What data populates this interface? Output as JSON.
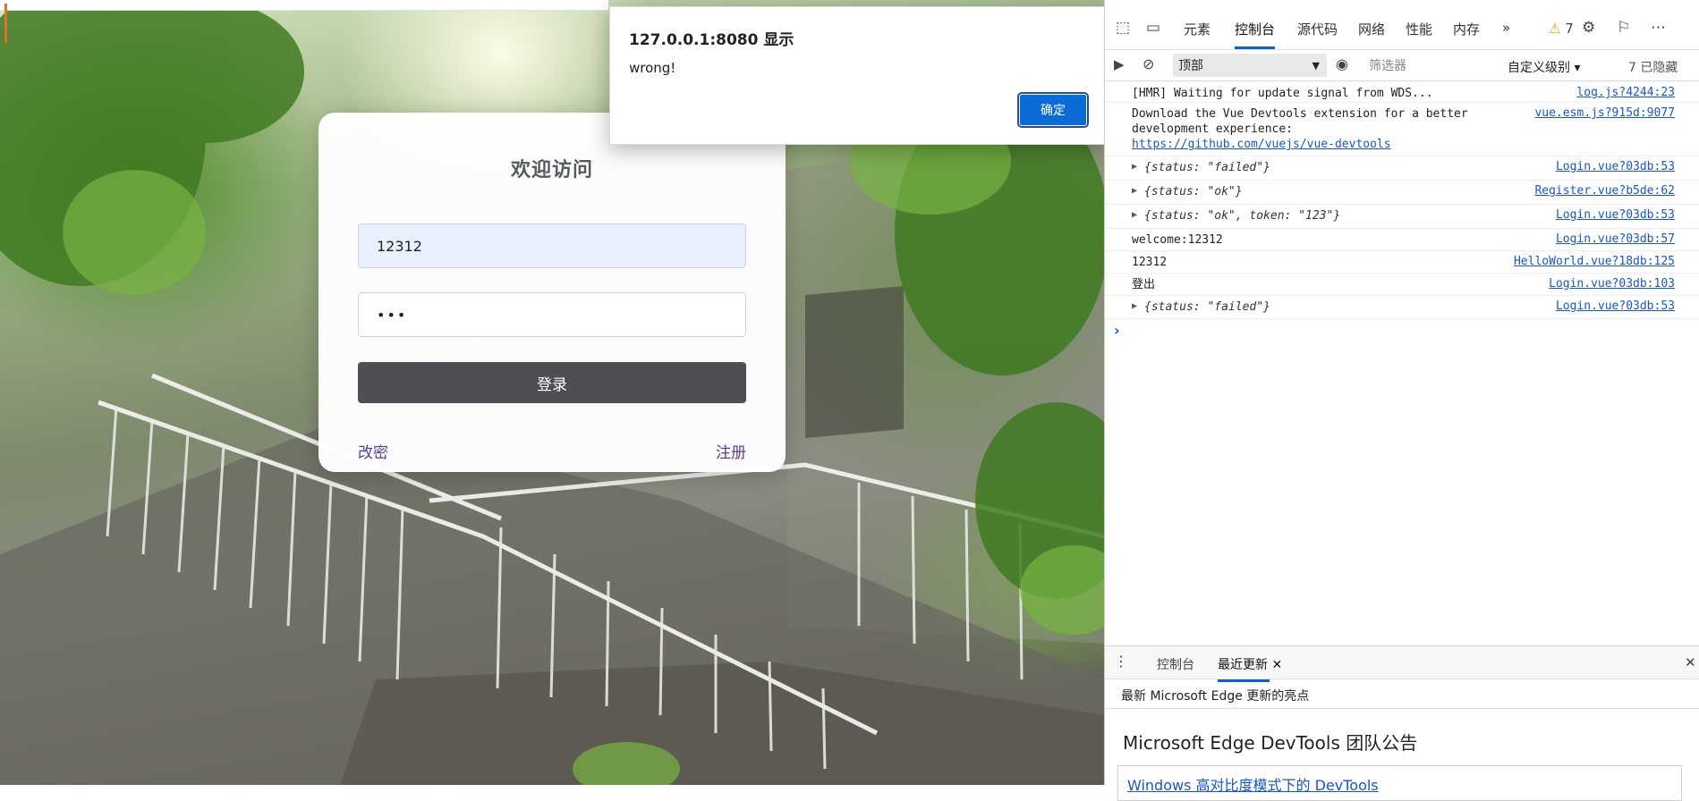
{
  "login": {
    "title": "欢迎访问",
    "username_value": "12312",
    "password_value": "•••",
    "submit_label": "登录",
    "change_password_link": "改密",
    "register_link": "注册"
  },
  "alert": {
    "title": "127.0.0.1:8080 显示",
    "message": "wrong!",
    "ok_label": "确定"
  },
  "devtools": {
    "tabs": [
      "元素",
      "控制台",
      "源代码",
      "网络",
      "性能",
      "内存"
    ],
    "active_tab": "控制台",
    "more_tabs": "»",
    "warning_count": "7",
    "toolbar": {
      "context": "顶部",
      "filter_placeholder": "筛选器",
      "level": "自定义级别 ▾",
      "hidden": "7 已隐藏"
    },
    "console_rows": [
      {
        "msg": "[HMR] Waiting for update signal from WDS...",
        "source": "log.js?4244:23"
      },
      {
        "msg1": "Download the Vue Devtools extension for a better",
        "msg2": "development experience:",
        "link": "https://github.com/vuejs/vue-devtools",
        "source": "vue.esm.js?915d:9077"
      },
      {
        "obj": "{status: \"failed\"}",
        "source": "Login.vue?03db:53"
      },
      {
        "obj": "{status: \"ok\"}",
        "source": "Register.vue?b5de:62"
      },
      {
        "obj": "{status: \"ok\", token: \"123\"}",
        "source": "Login.vue?03db:53"
      },
      {
        "msg": "welcome:12312",
        "source": "Login.vue?03db:57"
      },
      {
        "msg": "12312",
        "source": "HelloWorld.vue?18db:125"
      },
      {
        "msg": "登出",
        "source": "Login.vue?03db:103"
      },
      {
        "obj": "{status: \"failed\"}",
        "source": "Login.vue?03db:53"
      }
    ],
    "drawer": {
      "tabs": [
        "控制台",
        "最近更新"
      ],
      "active": "最近更新",
      "whatsnew_header": "最新 Microsoft Edge 更新的亮点",
      "news_title": "Microsoft Edge DevTools 团队公告",
      "news_link": "Windows 高对比度模式下的 DevTools"
    }
  },
  "colors": {
    "accent": "#0a62d0",
    "button_dark": "#4d4f53",
    "link_purple": "#5a3c9a"
  }
}
